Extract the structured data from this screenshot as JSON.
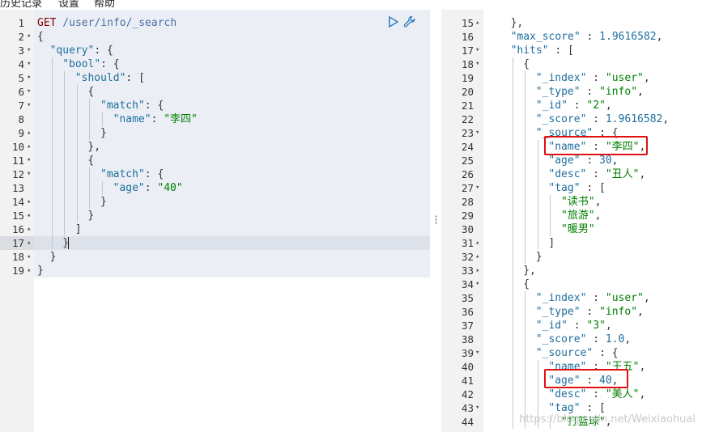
{
  "menu": [
    "历史记录",
    "设置",
    "帮助"
  ],
  "left_lines": [
    {
      "n": "1",
      "fold": "",
      "indent": 0,
      "tokens": [
        {
          "t": "GET",
          "c": "k"
        },
        {
          "t": " /user/info/_search",
          "c": "u"
        }
      ]
    },
    {
      "n": "2",
      "fold": "▾",
      "indent": 0,
      "tokens": [
        {
          "t": "{",
          "c": "p"
        }
      ]
    },
    {
      "n": "3",
      "fold": "▾",
      "indent": 1,
      "tokens": [
        {
          "t": "\"query\"",
          "c": "s"
        },
        {
          "t": ": {",
          "c": "p"
        }
      ]
    },
    {
      "n": "4",
      "fold": "▾",
      "indent": 2,
      "tokens": [
        {
          "t": "\"bool\"",
          "c": "s"
        },
        {
          "t": ": {",
          "c": "p"
        }
      ]
    },
    {
      "n": "5",
      "fold": "▾",
      "indent": 3,
      "tokens": [
        {
          "t": "\"should\"",
          "c": "s"
        },
        {
          "t": ": [",
          "c": "p"
        }
      ]
    },
    {
      "n": "6",
      "fold": "▾",
      "indent": 4,
      "tokens": [
        {
          "t": "{",
          "c": "p"
        }
      ]
    },
    {
      "n": "7",
      "fold": "▾",
      "indent": 5,
      "tokens": [
        {
          "t": "\"match\"",
          "c": "s"
        },
        {
          "t": ": {",
          "c": "p"
        }
      ]
    },
    {
      "n": "8",
      "fold": "",
      "indent": 6,
      "tokens": [
        {
          "t": "\"name\"",
          "c": "s"
        },
        {
          "t": ": ",
          "c": "p"
        },
        {
          "t": "\"李四\"",
          "c": "v"
        }
      ]
    },
    {
      "n": "9",
      "fold": "▴",
      "indent": 5,
      "tokens": [
        {
          "t": "}",
          "c": "p"
        }
      ]
    },
    {
      "n": "10",
      "fold": "▴",
      "indent": 4,
      "tokens": [
        {
          "t": "},",
          "c": "p"
        }
      ]
    },
    {
      "n": "11",
      "fold": "▾",
      "indent": 4,
      "tokens": [
        {
          "t": "{",
          "c": "p"
        }
      ]
    },
    {
      "n": "12",
      "fold": "▾",
      "indent": 5,
      "tokens": [
        {
          "t": "\"match\"",
          "c": "s"
        },
        {
          "t": ": {",
          "c": "p"
        }
      ]
    },
    {
      "n": "13",
      "fold": "",
      "indent": 6,
      "tokens": [
        {
          "t": "\"age\"",
          "c": "s"
        },
        {
          "t": ": ",
          "c": "p"
        },
        {
          "t": "\"40\"",
          "c": "v"
        }
      ]
    },
    {
      "n": "14",
      "fold": "▴",
      "indent": 5,
      "tokens": [
        {
          "t": "}",
          "c": "p"
        }
      ]
    },
    {
      "n": "15",
      "fold": "▴",
      "indent": 4,
      "tokens": [
        {
          "t": "}",
          "c": "p"
        }
      ]
    },
    {
      "n": "16",
      "fold": "▴",
      "indent": 3,
      "tokens": [
        {
          "t": "]",
          "c": "p"
        }
      ]
    },
    {
      "n": "17",
      "fold": "▴",
      "indent": 2,
      "tokens": [
        {
          "t": "}",
          "c": "p"
        }
      ]
    },
    {
      "n": "18",
      "fold": "▴",
      "indent": 1,
      "tokens": [
        {
          "t": "}",
          "c": "p"
        }
      ]
    },
    {
      "n": "19",
      "fold": "▴",
      "indent": 0,
      "tokens": [
        {
          "t": "}",
          "c": "p"
        }
      ]
    }
  ],
  "right_lines": [
    {
      "n": "15",
      "fold": "▴",
      "indent": 1,
      "tokens": [
        {
          "t": "},",
          "c": "p"
        }
      ]
    },
    {
      "n": "16",
      "fold": "",
      "indent": 1,
      "tokens": [
        {
          "t": "\"max_score\"",
          "c": "s"
        },
        {
          "t": " : ",
          "c": "p"
        },
        {
          "t": "1.9616582",
          "c": "n"
        },
        {
          "t": ",",
          "c": "p"
        }
      ]
    },
    {
      "n": "17",
      "fold": "▾",
      "indent": 1,
      "tokens": [
        {
          "t": "\"hits\"",
          "c": "s"
        },
        {
          "t": " : [",
          "c": "p"
        }
      ]
    },
    {
      "n": "18",
      "fold": "▾",
      "indent": 2,
      "tokens": [
        {
          "t": "{",
          "c": "p"
        }
      ]
    },
    {
      "n": "19",
      "fold": "",
      "indent": 3,
      "tokens": [
        {
          "t": "\"_index\"",
          "c": "s"
        },
        {
          "t": " : ",
          "c": "p"
        },
        {
          "t": "\"user\"",
          "c": "v"
        },
        {
          "t": ",",
          "c": "p"
        }
      ]
    },
    {
      "n": "20",
      "fold": "",
      "indent": 3,
      "tokens": [
        {
          "t": "\"_type\"",
          "c": "s"
        },
        {
          "t": " : ",
          "c": "p"
        },
        {
          "t": "\"info\"",
          "c": "v"
        },
        {
          "t": ",",
          "c": "p"
        }
      ]
    },
    {
      "n": "21",
      "fold": "",
      "indent": 3,
      "tokens": [
        {
          "t": "\"_id\"",
          "c": "s"
        },
        {
          "t": " : ",
          "c": "p"
        },
        {
          "t": "\"2\"",
          "c": "v"
        },
        {
          "t": ",",
          "c": "p"
        }
      ]
    },
    {
      "n": "22",
      "fold": "",
      "indent": 3,
      "tokens": [
        {
          "t": "\"_score\"",
          "c": "s"
        },
        {
          "t": " : ",
          "c": "p"
        },
        {
          "t": "1.9616582",
          "c": "n"
        },
        {
          "t": ",",
          "c": "p"
        }
      ]
    },
    {
      "n": "23",
      "fold": "▾",
      "indent": 3,
      "tokens": [
        {
          "t": "\"_source\"",
          "c": "s"
        },
        {
          "t": " : {",
          "c": "p"
        }
      ]
    },
    {
      "n": "24",
      "fold": "",
      "indent": 4,
      "tokens": [
        {
          "t": "\"name\"",
          "c": "s"
        },
        {
          "t": " : ",
          "c": "p"
        },
        {
          "t": "\"李四\"",
          "c": "v"
        },
        {
          "t": ",",
          "c": "p"
        }
      ]
    },
    {
      "n": "25",
      "fold": "",
      "indent": 4,
      "tokens": [
        {
          "t": "\"age\"",
          "c": "s"
        },
        {
          "t": " : ",
          "c": "p"
        },
        {
          "t": "30",
          "c": "n"
        },
        {
          "t": ",",
          "c": "p"
        }
      ]
    },
    {
      "n": "26",
      "fold": "",
      "indent": 4,
      "tokens": [
        {
          "t": "\"desc\"",
          "c": "s"
        },
        {
          "t": " : ",
          "c": "p"
        },
        {
          "t": "\"丑人\"",
          "c": "v"
        },
        {
          "t": ",",
          "c": "p"
        }
      ]
    },
    {
      "n": "27",
      "fold": "▾",
      "indent": 4,
      "tokens": [
        {
          "t": "\"tag\"",
          "c": "s"
        },
        {
          "t": " : [",
          "c": "p"
        }
      ]
    },
    {
      "n": "28",
      "fold": "",
      "indent": 5,
      "tokens": [
        {
          "t": "\"读书\"",
          "c": "v"
        },
        {
          "t": ",",
          "c": "p"
        }
      ]
    },
    {
      "n": "29",
      "fold": "",
      "indent": 5,
      "tokens": [
        {
          "t": "\"旅游\"",
          "c": "v"
        },
        {
          "t": ",",
          "c": "p"
        }
      ]
    },
    {
      "n": "30",
      "fold": "",
      "indent": 5,
      "tokens": [
        {
          "t": "\"暖男\"",
          "c": "v"
        }
      ]
    },
    {
      "n": "31",
      "fold": "▴",
      "indent": 4,
      "tokens": [
        {
          "t": "]",
          "c": "p"
        }
      ]
    },
    {
      "n": "32",
      "fold": "▴",
      "indent": 3,
      "tokens": [
        {
          "t": "}",
          "c": "p"
        }
      ]
    },
    {
      "n": "33",
      "fold": "▴",
      "indent": 2,
      "tokens": [
        {
          "t": "},",
          "c": "p"
        }
      ]
    },
    {
      "n": "34",
      "fold": "▾",
      "indent": 2,
      "tokens": [
        {
          "t": "{",
          "c": "p"
        }
      ]
    },
    {
      "n": "35",
      "fold": "",
      "indent": 3,
      "tokens": [
        {
          "t": "\"_index\"",
          "c": "s"
        },
        {
          "t": " : ",
          "c": "p"
        },
        {
          "t": "\"user\"",
          "c": "v"
        },
        {
          "t": ",",
          "c": "p"
        }
      ]
    },
    {
      "n": "36",
      "fold": "",
      "indent": 3,
      "tokens": [
        {
          "t": "\"_type\"",
          "c": "s"
        },
        {
          "t": " : ",
          "c": "p"
        },
        {
          "t": "\"info\"",
          "c": "v"
        },
        {
          "t": ",",
          "c": "p"
        }
      ]
    },
    {
      "n": "37",
      "fold": "",
      "indent": 3,
      "tokens": [
        {
          "t": "\"_id\"",
          "c": "s"
        },
        {
          "t": " : ",
          "c": "p"
        },
        {
          "t": "\"3\"",
          "c": "v"
        },
        {
          "t": ",",
          "c": "p"
        }
      ]
    },
    {
      "n": "38",
      "fold": "",
      "indent": 3,
      "tokens": [
        {
          "t": "\"_score\"",
          "c": "s"
        },
        {
          "t": " : ",
          "c": "p"
        },
        {
          "t": "1.0",
          "c": "n"
        },
        {
          "t": ",",
          "c": "p"
        }
      ]
    },
    {
      "n": "39",
      "fold": "▾",
      "indent": 3,
      "tokens": [
        {
          "t": "\"_source\"",
          "c": "s"
        },
        {
          "t": " : {",
          "c": "p"
        }
      ]
    },
    {
      "n": "40",
      "fold": "",
      "indent": 4,
      "tokens": [
        {
          "t": "\"name\"",
          "c": "s"
        },
        {
          "t": " : ",
          "c": "p"
        },
        {
          "t": "\"王五\"",
          "c": "v"
        },
        {
          "t": ",",
          "c": "p"
        }
      ]
    },
    {
      "n": "41",
      "fold": "",
      "indent": 4,
      "tokens": [
        {
          "t": "\"age\"",
          "c": "s"
        },
        {
          "t": " : ",
          "c": "p"
        },
        {
          "t": "40",
          "c": "n"
        },
        {
          "t": ",",
          "c": "p"
        }
      ]
    },
    {
      "n": "42",
      "fold": "",
      "indent": 4,
      "tokens": [
        {
          "t": "\"desc\"",
          "c": "s"
        },
        {
          "t": " : ",
          "c": "p"
        },
        {
          "t": "\"美人\"",
          "c": "v"
        },
        {
          "t": ",",
          "c": "p"
        }
      ]
    },
    {
      "n": "43",
      "fold": "▾",
      "indent": 4,
      "tokens": [
        {
          "t": "\"tag\"",
          "c": "s"
        },
        {
          "t": " : [",
          "c": "p"
        }
      ]
    },
    {
      "n": "44",
      "fold": "",
      "indent": 5,
      "tokens": [
        {
          "t": "\"打篮球\"",
          "c": "v"
        },
        {
          "t": ",",
          "c": "p"
        }
      ]
    }
  ],
  "icons": {
    "run": "play-icon",
    "settings": "wrench-icon",
    "splitter": "drag-handle-icon"
  },
  "watermark": "https://blog.csdn.net/Weixiaohual",
  "colors": {
    "highlight": "#e01010",
    "active_line": "#dce1ea"
  }
}
